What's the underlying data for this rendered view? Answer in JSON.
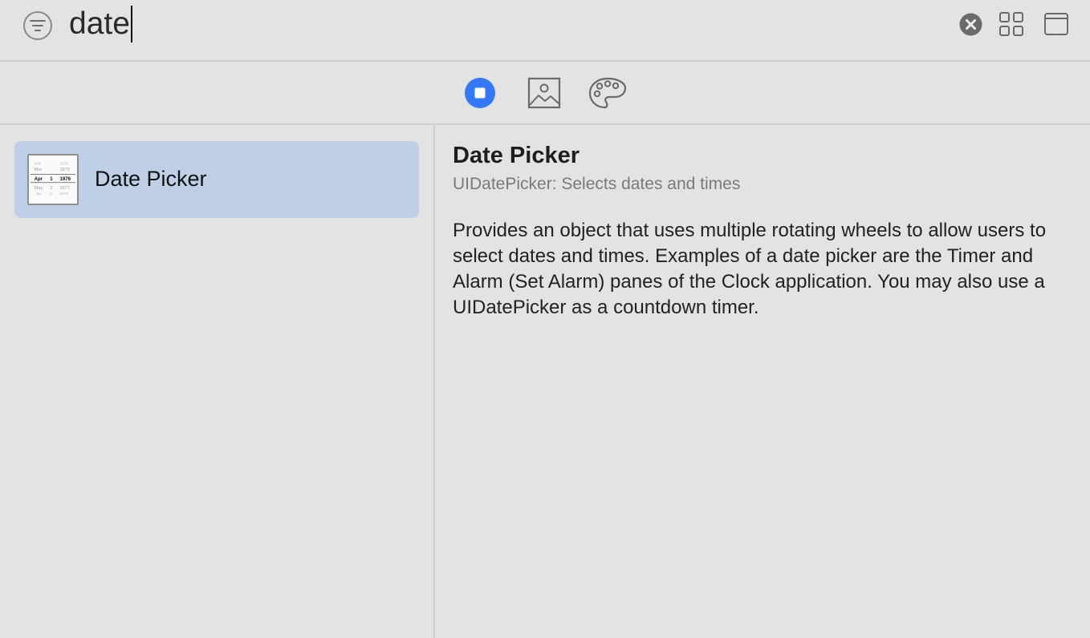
{
  "search": {
    "value": "date"
  },
  "icons": {
    "filter": "filter-icon",
    "clear": "clear-icon",
    "grid": "grid-view-icon",
    "window": "window-icon",
    "components": "components-icon",
    "media": "media-icon",
    "colors": "palette-icon"
  },
  "colors": {
    "accent": "#3478f6",
    "selection": "#bfcfe6",
    "background": "#e3e3e3"
  },
  "library": {
    "items": [
      {
        "label": "Date Picker",
        "thumbnail": {
          "rows": [
            {
              "month": "Feb",
              "day": "",
              "year": "1974"
            },
            {
              "month": "Mar",
              "day": "",
              "year": "1975"
            },
            {
              "month": "Apr",
              "day": "1",
              "year": "1976"
            },
            {
              "month": "May",
              "day": "2",
              "year": "1977"
            },
            {
              "month": "Jun",
              "day": "3",
              "year": "1978"
            }
          ]
        }
      }
    ]
  },
  "detail": {
    "title": "Date Picker",
    "subtitle": "UIDatePicker: Selects dates and times",
    "description": "Provides an object that uses multiple rotating wheels to allow users to select dates and times. Examples of a date picker are the Timer and Alarm (Set Alarm) panes of the Clock application. You may also use a UIDatePicker as a countdown timer."
  }
}
